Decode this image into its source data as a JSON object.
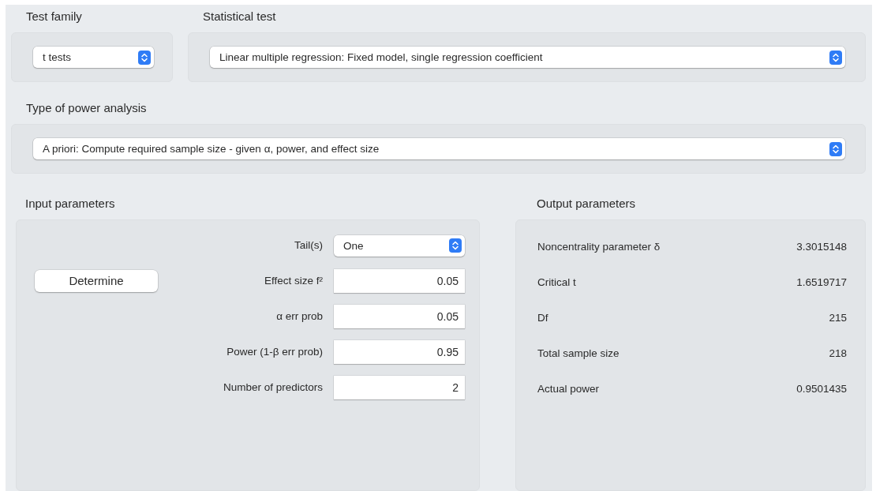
{
  "test_family": {
    "label": "Test family",
    "value": "t tests"
  },
  "statistical_test": {
    "label": "Statistical test",
    "value": "Linear multiple regression: Fixed model, single regression coefficient"
  },
  "power_analysis_type": {
    "label": "Type of power analysis",
    "value": "A priori: Compute required sample size - given α, power, and effect size"
  },
  "input_parameters": {
    "label": "Input parameters",
    "determine_button": "Determine",
    "rows": [
      {
        "kind": "popup",
        "label": "Tail(s)",
        "value": "One"
      },
      {
        "kind": "field",
        "label": "Effect size f²",
        "value": "0.05"
      },
      {
        "kind": "field",
        "label": "α err prob",
        "value": "0.05"
      },
      {
        "kind": "field",
        "label": "Power (1-β err prob)",
        "value": "0.95"
      },
      {
        "kind": "field",
        "label": "Number of predictors",
        "value": "2"
      }
    ]
  },
  "output_parameters": {
    "label": "Output parameters",
    "rows": [
      {
        "label": "Noncentrality parameter δ",
        "value": "3.3015148"
      },
      {
        "label": "Critical t",
        "value": "1.6519717"
      },
      {
        "label": "Df",
        "value": "215"
      },
      {
        "label": "Total sample size",
        "value": "218"
      },
      {
        "label": "Actual power",
        "value": "0.9501435"
      }
    ]
  }
}
